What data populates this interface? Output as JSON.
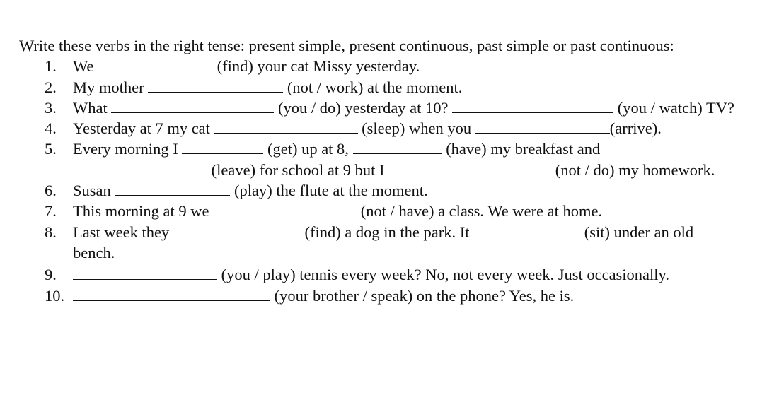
{
  "instruction": "Write these verbs in the right tense: present simple, present continuous, past simple or past continuous:",
  "items": [
    {
      "num": "1.",
      "parts": [
        "We",
        "(find) your cat Missy yesterday."
      ]
    },
    {
      "num": "2.",
      "parts": [
        "My mother",
        "(not / work) at the moment."
      ]
    },
    {
      "num": "3.",
      "parts": [
        "What",
        "(you / do) yesterday at 10?",
        "(you / watch) TV?"
      ]
    },
    {
      "num": "4.",
      "parts": [
        "Yesterday at 7 my cat",
        "(sleep) when you",
        "(arrive)."
      ]
    },
    {
      "num": "5.",
      "parts": [
        "Every morning I",
        "(get) up at 8,",
        "(have) my breakfast and",
        "(leave) for school at 9 but I",
        "(not / do) my homework."
      ]
    },
    {
      "num": "6.",
      "parts": [
        "Susan",
        "(play) the flute at the moment."
      ]
    },
    {
      "num": "7.",
      "parts": [
        "This morning at 9 we",
        "(not / have) a class. We were at home."
      ]
    },
    {
      "num": "8.",
      "parts": [
        "Last week they",
        "(find) a dog in the park. It",
        "(sit) under an old bench."
      ]
    },
    {
      "num": "9.",
      "parts": [
        "(you / play) tennis every week? No, not every week. Just occasionally."
      ]
    },
    {
      "num": "10.",
      "parts": [
        "(your brother / speak) on the phone? Yes, he is."
      ]
    }
  ]
}
